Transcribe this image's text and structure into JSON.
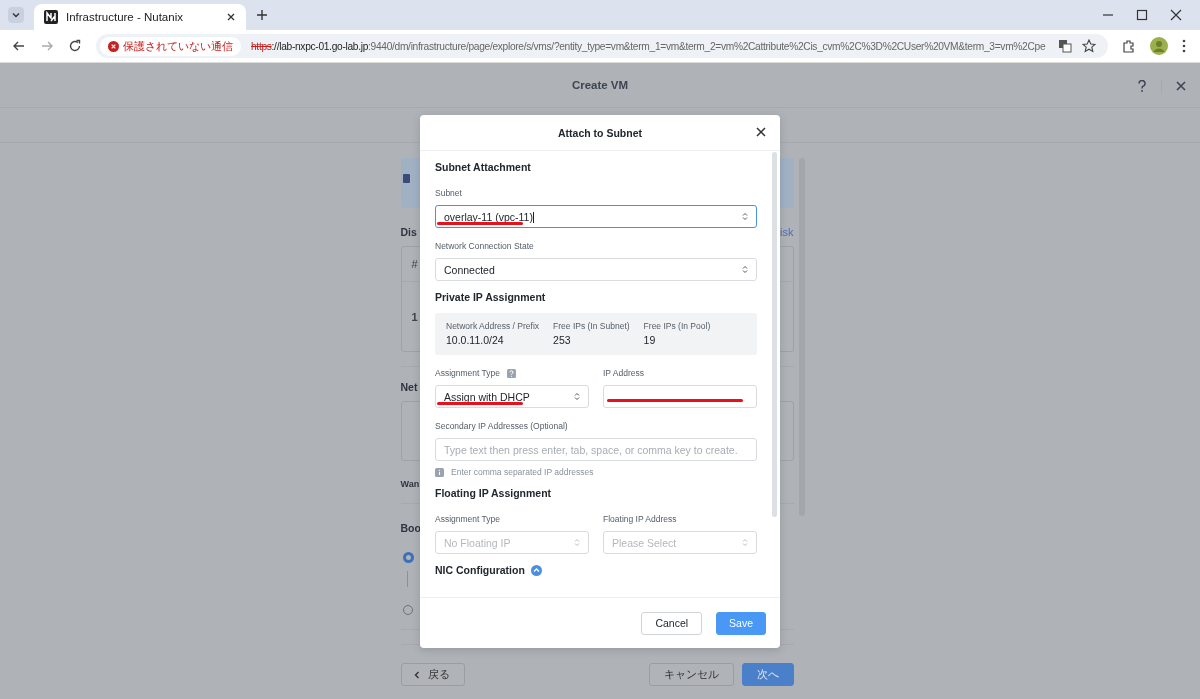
{
  "browser": {
    "tab_title": "Infrastructure - Nutanix",
    "security_label": "保護されていない通信",
    "url": {
      "scheme": "https",
      "host": "://lab-nxpc-01.go-lab.jp",
      "path": ":9440/dm/infrastructure/page/explore/s/vms/?entity_type=vm&term_1=vm&term_2=vm%2Cattribute%2Cis_cvm%2C%3D%2CUser%20VM&term_3=vm%2Cpe"
    }
  },
  "page": {
    "title": "Create VM",
    "fragments": {
      "disk_heading": "Dis",
      "disk_link": "isk",
      "table_header": "#",
      "table_row": "1",
      "network_heading": "Net",
      "want_label": "Wan",
      "boot_heading": "Boo"
    },
    "boot_options": [
      {
        "selected": true
      },
      {
        "selected": false
      }
    ]
  },
  "dialog": {
    "title": "Attach to Subnet",
    "sections": [
      {
        "heading": "Subnet Attachment",
        "rows": [
          [
            {
              "label": "Subnet",
              "kind": "select",
              "value": "overlay-11 (vpc-11)",
              "focused": true,
              "annotated": true,
              "disabled": false
            }
          ],
          [
            {
              "label": "Network Connection State",
              "kind": "select",
              "value": "Connected",
              "focused": false,
              "disabled": false
            }
          ]
        ]
      },
      {
        "heading": "Private IP Assignment",
        "summary": [
          {
            "label": "Network Address / Prefix",
            "value": "10.0.11.0/24"
          },
          {
            "label": "Free IPs (In Subnet)",
            "value": "253"
          },
          {
            "label": "Free IPs (In Pool)",
            "value": "19"
          }
        ],
        "rows": [
          [
            {
              "label": "Assignment Type",
              "help": true,
              "kind": "select",
              "value": "Assign with DHCP",
              "focused": false,
              "annotated": true,
              "disabled": false
            },
            {
              "label": "IP Address",
              "kind": "input",
              "focused": false,
              "annotated": true,
              "disabled": false
            }
          ],
          [
            {
              "label": "Secondary IP Addresses (Optional)",
              "kind": "input",
              "placeholder": "Type text then press enter, tab, space, or comma key to create.",
              "hint": "Enter comma separated IP addresses",
              "focused": false,
              "disabled": false
            }
          ]
        ]
      },
      {
        "heading": "Floating IP Assignment",
        "rows": [
          [
            {
              "label": "Assignment Type",
              "kind": "select",
              "value": "No Floating IP",
              "focused": false,
              "disabled": true
            },
            {
              "label": "Floating IP Address",
              "kind": "select",
              "placeholder": "Please Select",
              "focused": false,
              "disabled": true
            }
          ]
        ]
      },
      {
        "heading": "NIC Configuration",
        "expanded": true
      }
    ],
    "buttons": [
      {
        "label": "Cancel",
        "kind": "secondary"
      },
      {
        "label": "Save",
        "kind": "primary"
      }
    ]
  },
  "wizard_buttons": [
    {
      "label": "戻る",
      "kind": "back"
    },
    {
      "label": "キャンセル",
      "kind": "secondary"
    },
    {
      "label": "次へ",
      "kind": "primary"
    }
  ]
}
